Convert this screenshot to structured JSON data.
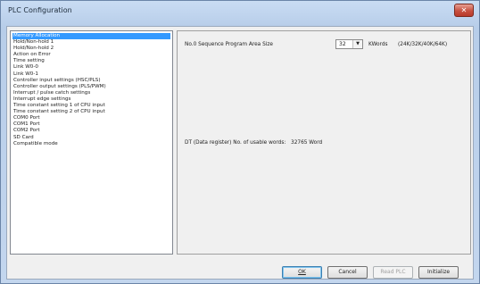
{
  "window": {
    "title": "PLC Configuration",
    "close_label": "✕"
  },
  "sidebar": {
    "items": [
      {
        "label": "Memory Allocation"
      },
      {
        "label": "Hold/Non-hold 1"
      },
      {
        "label": "Hold/Non-hold 2"
      },
      {
        "label": "Action on Error"
      },
      {
        "label": "Time setting"
      },
      {
        "label": "Link W0-0"
      },
      {
        "label": "Link W0-1"
      },
      {
        "label": "Controller input settings (HSC/PLS)"
      },
      {
        "label": "Controller output settings (PLS/PWM)"
      },
      {
        "label": "Interrupt / pulse catch settings"
      },
      {
        "label": "Interrupt edge settings"
      },
      {
        "label": "Time constant setting 1 of CPU input"
      },
      {
        "label": "Time constant setting 2 of CPU input"
      },
      {
        "label": "COM0 Port"
      },
      {
        "label": "COM1 Port"
      },
      {
        "label": "COM2 Port"
      },
      {
        "label": "SD Card"
      },
      {
        "label": "Compatible mode"
      }
    ],
    "selected_index": 0
  },
  "memory": {
    "program_area_label": "No.0 Sequence Program Area Size",
    "program_area_value": "32",
    "units_label": "KWords",
    "options_hint": "(24K/32K/40K/64K)",
    "dt_label": "DT (Data register) No. of usable words:",
    "dt_value": "32765 Word"
  },
  "buttons": {
    "ok": "OK",
    "cancel": "Cancel",
    "read_plc": "Read PLC",
    "initialize": "Initialize"
  }
}
